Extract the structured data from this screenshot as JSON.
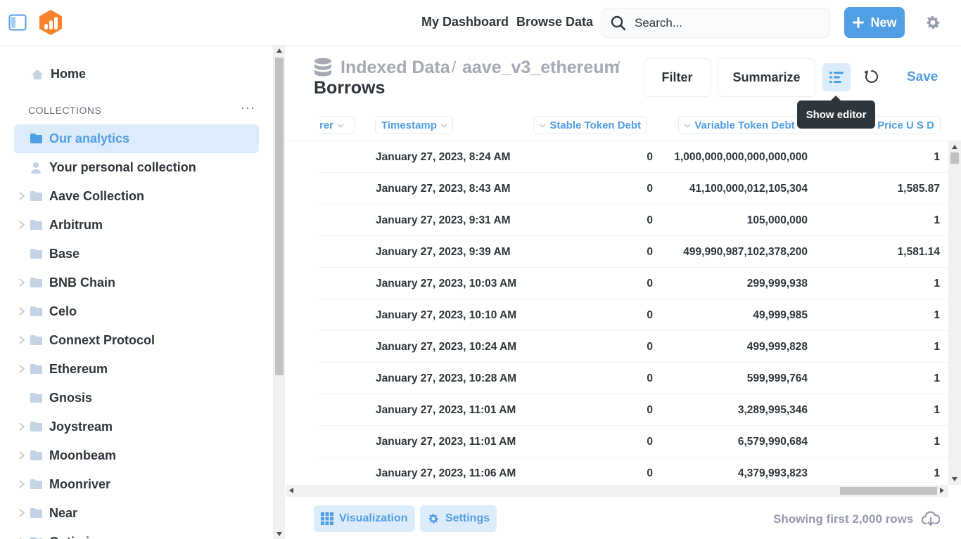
{
  "topbar": {
    "nav": [
      "My Dashboard",
      "Browse Data"
    ],
    "search_placeholder": "Search...",
    "new_label": "New"
  },
  "sidebar": {
    "home_label": "Home",
    "collections_header": "COLLECTIONS",
    "more": "···",
    "items": [
      {
        "label": "Our analytics",
        "active": true,
        "expandable": false,
        "icon": "folder-icon"
      },
      {
        "label": "Your personal collection",
        "active": false,
        "expandable": false,
        "icon": "person-icon"
      },
      {
        "label": "Aave Collection",
        "active": false,
        "expandable": true,
        "icon": "folder-icon"
      },
      {
        "label": "Arbitrum",
        "active": false,
        "expandable": true,
        "icon": "folder-icon"
      },
      {
        "label": "Base",
        "active": false,
        "expandable": false,
        "icon": "folder-icon"
      },
      {
        "label": "BNB Chain",
        "active": false,
        "expandable": true,
        "icon": "folder-icon"
      },
      {
        "label": "Celo",
        "active": false,
        "expandable": true,
        "icon": "folder-icon"
      },
      {
        "label": "Connext Protocol",
        "active": false,
        "expandable": true,
        "icon": "folder-icon"
      },
      {
        "label": "Ethereum",
        "active": false,
        "expandable": true,
        "icon": "folder-icon"
      },
      {
        "label": "Gnosis",
        "active": false,
        "expandable": false,
        "icon": "folder-icon"
      },
      {
        "label": "Joystream",
        "active": false,
        "expandable": true,
        "icon": "folder-icon"
      },
      {
        "label": "Moonbeam",
        "active": false,
        "expandable": true,
        "icon": "folder-icon"
      },
      {
        "label": "Moonriver",
        "active": false,
        "expandable": true,
        "icon": "folder-icon"
      },
      {
        "label": "Near",
        "active": false,
        "expandable": true,
        "icon": "folder-icon"
      },
      {
        "label": "Optimism",
        "active": false,
        "expandable": true,
        "icon": "folder-icon"
      }
    ]
  },
  "header": {
    "breadcrumbs": [
      "Indexed Data",
      "aave_v3_ethereum"
    ],
    "separator": "/",
    "title": "Borrows",
    "filter_label": "Filter",
    "summarize_label": "Summarize",
    "save_label": "Save",
    "tooltip": "Show editor"
  },
  "table": {
    "columns": [
      "rer",
      "Timestamp",
      "Stable Token Debt",
      "Variable Token Debt",
      "Price U S D"
    ],
    "rows": [
      [
        "January 27, 2023, 8:24 AM",
        "0",
        "1,000,000,000,000,000,000",
        "1"
      ],
      [
        "January 27, 2023, 8:43 AM",
        "0",
        "41,100,000,012,105,304",
        "1,585.87"
      ],
      [
        "January 27, 2023, 9:31 AM",
        "0",
        "105,000,000",
        "1"
      ],
      [
        "January 27, 2023, 9:39 AM",
        "0",
        "499,990,987,102,378,200",
        "1,581.14"
      ],
      [
        "January 27, 2023, 10:03 AM",
        "0",
        "299,999,938",
        "1"
      ],
      [
        "January 27, 2023, 10:10 AM",
        "0",
        "49,999,985",
        "1"
      ],
      [
        "January 27, 2023, 10:24 AM",
        "0",
        "499,999,828",
        "1"
      ],
      [
        "January 27, 2023, 10:28 AM",
        "0",
        "599,999,764",
        "1"
      ],
      [
        "January 27, 2023, 11:01 AM",
        "0",
        "3,289,995,346",
        "1"
      ],
      [
        "January 27, 2023, 11:01 AM",
        "0",
        "6,579,990,684",
        "1"
      ],
      [
        "January 27, 2023, 11:06 AM",
        "0",
        "4,379,993,823",
        "1"
      ]
    ]
  },
  "footer": {
    "visualization_label": "Visualization",
    "settings_label": "Settings",
    "row_count": "Showing first 2,000 rows"
  },
  "colors": {
    "brand": "#509ee3",
    "brand_light": "#ddecfa",
    "text_dark": "#2e353b",
    "logo": "#f9822e"
  }
}
